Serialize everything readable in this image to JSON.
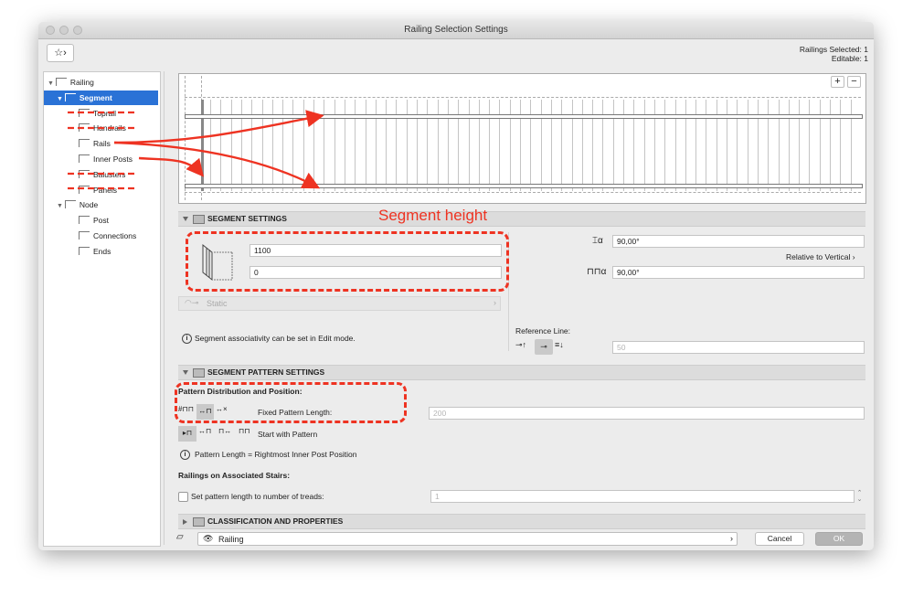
{
  "window": {
    "title": "Railing Selection Settings"
  },
  "header": {
    "railings_selected": "Railings Selected: 1",
    "editable": "Editable: 1"
  },
  "tree": {
    "items": [
      {
        "label": "Railing",
        "indent": 0,
        "icon": "railing-icon"
      },
      {
        "label": "Segment",
        "indent": 1,
        "icon": "segment-icon",
        "selected": true
      },
      {
        "label": "Toprail",
        "indent": 2,
        "icon": "toprail-icon",
        "struck": true
      },
      {
        "label": "Handrails",
        "indent": 2,
        "icon": "handrail-icon",
        "struck": true
      },
      {
        "label": "Rails",
        "indent": 2,
        "icon": "rail-icon"
      },
      {
        "label": "Inner Posts",
        "indent": 2,
        "icon": "inner-post-icon"
      },
      {
        "label": "Balusters",
        "indent": 2,
        "icon": "baluster-icon",
        "struck": true
      },
      {
        "label": "Panels",
        "indent": 2,
        "icon": "panel-icon",
        "struck": true
      },
      {
        "label": "Node",
        "indent": 1,
        "icon": "node-icon"
      },
      {
        "label": "Post",
        "indent": 2,
        "icon": "post-icon"
      },
      {
        "label": "Connections",
        "indent": 2,
        "icon": "connection-icon"
      },
      {
        "label": "Ends",
        "indent": 2,
        "icon": "end-icon"
      }
    ]
  },
  "preview": {
    "zoom_in": "+",
    "zoom_out": "−"
  },
  "segment_settings": {
    "title": "SEGMENT SETTINGS",
    "height_value": "1100",
    "offset_value": "0",
    "angle_alpha": "90,00°",
    "relative_label": "Relative to Vertical",
    "angle_beta": "90,00°",
    "associativity_value": "Static",
    "info_text": "Segment associativity can be set in Edit mode.",
    "reference_line_label": "Reference Line:",
    "reference_value": "50"
  },
  "pattern_settings": {
    "title": "SEGMENT PATTERN SETTINGS",
    "distribution_label": "Pattern Distribution and Position:",
    "fixed_length_label": "Fixed Pattern Length:",
    "fixed_length_value": "200",
    "start_label": "Start with Pattern",
    "info_text": "Pattern Length = Rightmost Inner Post Position",
    "stairs_label": "Railings on Associated Stairs:",
    "treads_label": "Set pattern length to number of treads:",
    "treads_value": "1"
  },
  "classification": {
    "title": "CLASSIFICATION AND PROPERTIES"
  },
  "footer": {
    "layer_value": "Railing",
    "cancel_label": "Cancel",
    "ok_label": "OK"
  },
  "annotation": {
    "segment_height_label": "Segment height"
  },
  "colors": {
    "selection": "#2a72d6",
    "annotation": "#ee3322"
  }
}
